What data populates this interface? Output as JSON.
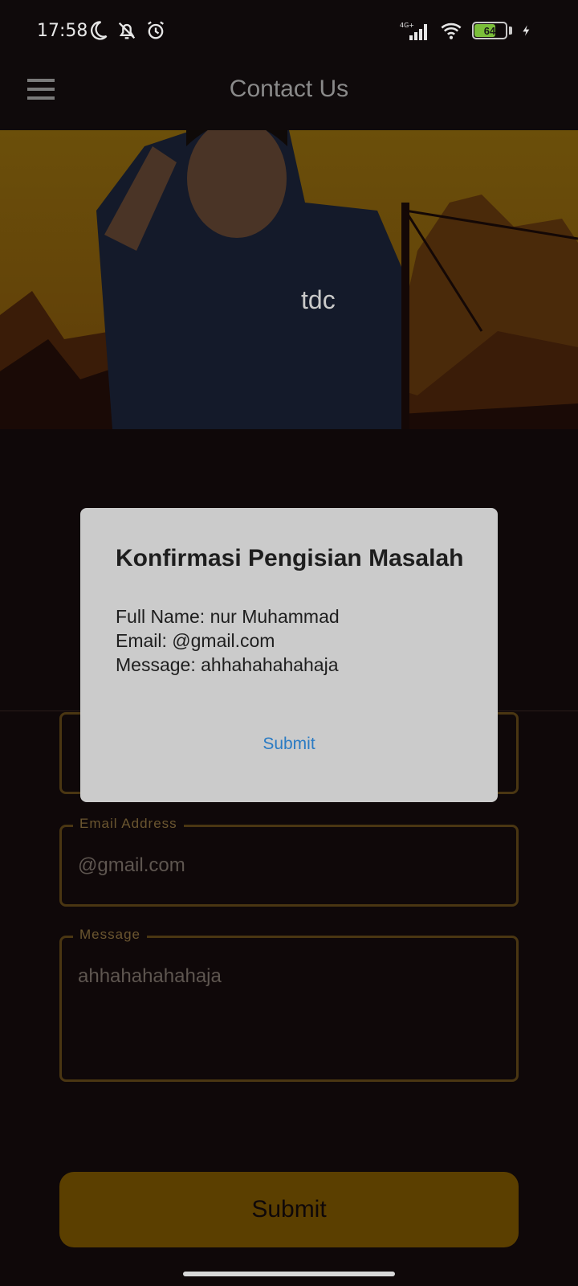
{
  "status_bar": {
    "time": "17:58",
    "network": "4G+",
    "battery_level": "64"
  },
  "app_bar": {
    "title": "Contact Us"
  },
  "hero": {
    "logo_text": "tdc"
  },
  "form": {
    "email": {
      "label": "Email Address",
      "value": "@gmail.com"
    },
    "message": {
      "label": "Message",
      "value": "ahhahahahahaja"
    },
    "submit_label": "Submit"
  },
  "dialog": {
    "title": "Konfirmasi Pengisian Masalah",
    "lines": [
      "Full Name: nur Muhammad",
      "Email: @gmail.com",
      "Message: ahhahahahahaja"
    ],
    "submit_label": "Submit"
  },
  "colors": {
    "accent": "#5b3f00",
    "dialog_bg": "#cbcbcb",
    "link_blue": "#2a7bc4"
  }
}
